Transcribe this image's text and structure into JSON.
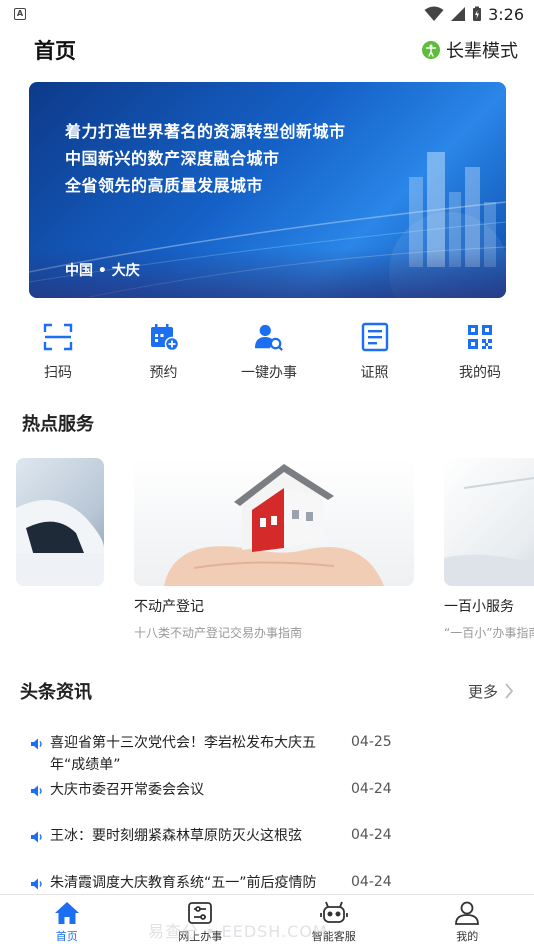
{
  "status_bar": {
    "time": "3:26",
    "notification_glyph": "A"
  },
  "header": {
    "title": "首页",
    "elder_mode_label": "长辈模式"
  },
  "banner": {
    "lines": [
      "着力打造世界著名的资源转型创新城市",
      "中国新兴的数产深度融合城市",
      "全省领先的高质量发展城市"
    ],
    "city": "中国 • 大庆"
  },
  "quick_actions": [
    {
      "label": "扫码",
      "icon": "scan-icon"
    },
    {
      "label": "预约",
      "icon": "calendar-add-icon"
    },
    {
      "label": "一键办事",
      "icon": "user-search-icon"
    },
    {
      "label": "证照",
      "icon": "certificate-icon"
    },
    {
      "label": "我的码",
      "icon": "qr-code-icon"
    }
  ],
  "hot_services": {
    "title": "热点服务",
    "items": [
      {
        "name": "",
        "desc": ""
      },
      {
        "name": "不动产登记",
        "desc": "十八类不动产登记交易办事指南"
      },
      {
        "name": "一百小服务",
        "desc": "“一百小”办事指南"
      }
    ]
  },
  "news": {
    "title": "头条资讯",
    "more_label": "更多",
    "items": [
      {
        "title": "喜迎省第十三次党代会！李岩松发布大庆五年“成绩单”",
        "date": "04-25"
      },
      {
        "title": "大庆市委召开常委会会议",
        "date": "04-24"
      },
      {
        "title": "王冰：要时刻绷紧森林草原防灭火这根弦",
        "date": "04-24"
      },
      {
        "title": "朱清霞调度大庆教育系统“五一”前后疫情防",
        "date": "04-24"
      }
    ]
  },
  "tabbar": [
    {
      "label": "首页",
      "icon": "home-icon",
      "active": true
    },
    {
      "label": "网上办事",
      "icon": "online-service-icon",
      "active": false
    },
    {
      "label": "智能客服",
      "icon": "robot-icon",
      "active": false
    },
    {
      "label": "我的",
      "icon": "person-icon",
      "active": false
    }
  ],
  "watermark": "易查分 • EEDSH.COM",
  "colors": {
    "primary": "#1c6ff0",
    "elder_green": "#5bbd3a",
    "banner_blue": "#1561c7"
  }
}
